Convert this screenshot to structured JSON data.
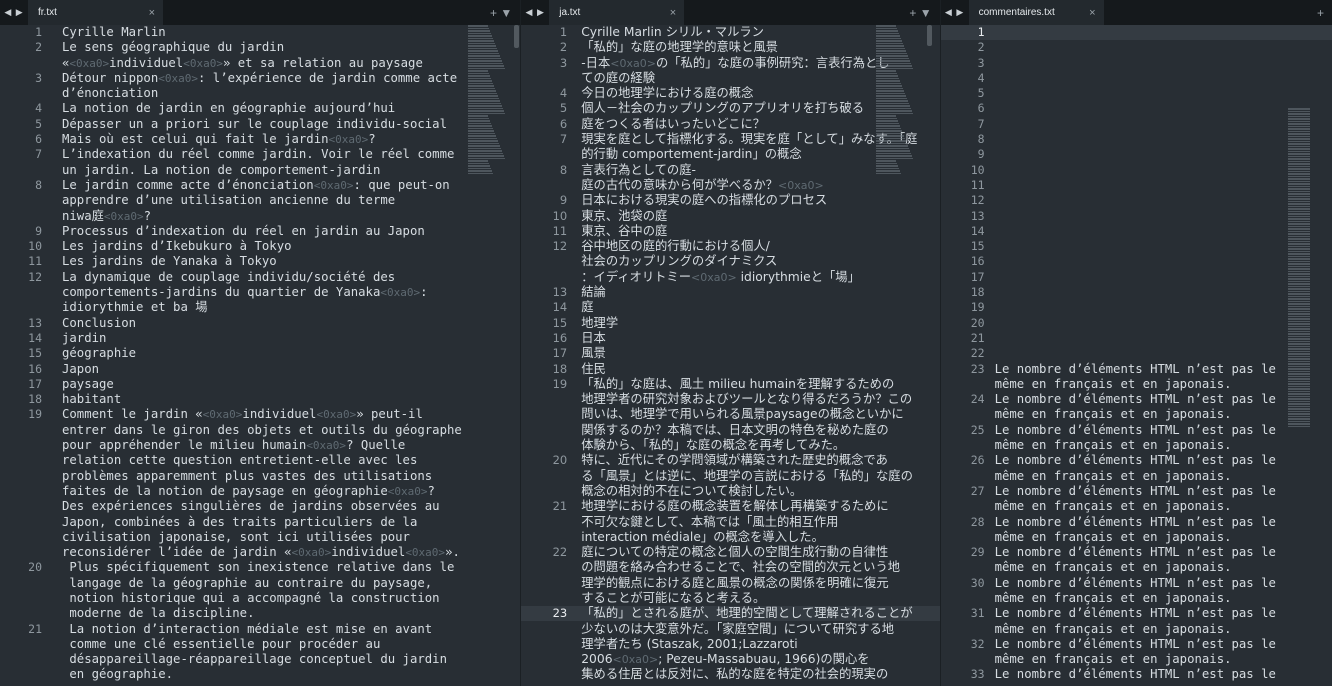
{
  "panes": [
    {
      "tab": "fr.txt",
      "rows": [
        {
          "n": "1",
          "t": "Cyrille Marlin"
        },
        {
          "n": "2",
          "t": "Le sens géographique du jardin"
        },
        {
          "n": "",
          "t": "«<0xa0>individuel<0xa0>» et sa relation au paysage"
        },
        {
          "n": "3",
          "t": "Détour nippon<0xa0>: l’expérience de jardin comme acte"
        },
        {
          "n": "",
          "t": "d’énonciation"
        },
        {
          "n": "4",
          "t": "La notion de jardin en géographie aujourd’hui"
        },
        {
          "n": "5",
          "t": "Dépasser un a priori sur le couplage individu-social"
        },
        {
          "n": "6",
          "t": "Mais où est celui qui fait le jardin<0xa0>?"
        },
        {
          "n": "7",
          "t": "L’indexation du réel comme jardin. Voir le réel comme"
        },
        {
          "n": "",
          "t": "un jardin. La notion de comportement-jardin"
        },
        {
          "n": "8",
          "t": "Le jardin comme acte d’énonciation<0xa0>: que peut-on"
        },
        {
          "n": "",
          "t": "apprendre d’une utilisation ancienne du terme"
        },
        {
          "n": "",
          "t": "niwa庭<0xa0>?"
        },
        {
          "n": "9",
          "t": "Processus d’indexation du réel en jardin au Japon"
        },
        {
          "n": "10",
          "t": "Les jardins d’Ikebukuro à Tokyo"
        },
        {
          "n": "11",
          "t": "Les jardins de Yanaka à Tokyo"
        },
        {
          "n": "12",
          "t": "La dynamique de couplage individu/société des"
        },
        {
          "n": "",
          "t": "comportements-jardins du quartier de Yanaka<0xa0>:"
        },
        {
          "n": "",
          "t": "idiorythmie et ba 場"
        },
        {
          "n": "13",
          "t": "Conclusion"
        },
        {
          "n": "14",
          "t": "jardin"
        },
        {
          "n": "15",
          "t": "géographie"
        },
        {
          "n": "16",
          "t": "Japon"
        },
        {
          "n": "17",
          "t": "paysage"
        },
        {
          "n": "18",
          "t": "habitant"
        },
        {
          "n": "19",
          "t": "Comment le jardin «<0xa0>individuel<0xa0>» peut-il"
        },
        {
          "n": "",
          "t": "entrer dans le giron des objets et outils du géographe"
        },
        {
          "n": "",
          "t": "pour appréhender le milieu humain<0xa0>? Quelle"
        },
        {
          "n": "",
          "t": "relation cette question entretient-elle avec les"
        },
        {
          "n": "",
          "t": "problèmes apparemment plus vastes des utilisations"
        },
        {
          "n": "",
          "t": "faites de la notion de paysage en géographie<0xa0>?"
        },
        {
          "n": "",
          "t": "Des expériences singulières de jardins observées au"
        },
        {
          "n": "",
          "t": "Japon, combinées à des traits particuliers de la"
        },
        {
          "n": "",
          "t": "civilisation japonaise, sont ici utilisées pour"
        },
        {
          "n": "",
          "t": "reconsidérer l’idée de jardin «<0xa0>individuel<0xa0>»."
        },
        {
          "n": "20",
          "t": " Plus spécifiquement son inexistence relative dans le"
        },
        {
          "n": "",
          "t": " langage de la géographie au contraire du paysage,"
        },
        {
          "n": "",
          "t": " notion historique qui a accompagné la construction"
        },
        {
          "n": "",
          "t": " moderne de la discipline."
        },
        {
          "n": "21",
          "t": " La notion d’interaction médiale est mise en avant"
        },
        {
          "n": "",
          "t": " comme une clé essentielle pour procéder au"
        },
        {
          "n": "",
          "t": " désappareillage-réappareillage conceptuel du jardin"
        },
        {
          "n": "",
          "t": " en géographie."
        }
      ]
    },
    {
      "tab": "ja.txt",
      "rows": [
        {
          "n": "1",
          "t": "Cyrille Marlin シリル・マルラン"
        },
        {
          "n": "2",
          "t": "「私的」な庭の地理学的意味と風景"
        },
        {
          "n": "3",
          "t": "-日本<0xa0>の「私的」な庭の事例研究：言表行為とし"
        },
        {
          "n": "",
          "t": "ての庭の経験"
        },
        {
          "n": "4",
          "t": "今日の地理学における庭の概念"
        },
        {
          "n": "5",
          "t": "個人－社会のカップリングのアプリオリを打ち破る"
        },
        {
          "n": "6",
          "t": "庭をつくる者はいったいどこに？"
        },
        {
          "n": "7",
          "t": "現実を庭として指標化する。現実を庭「として」みなす。「庭"
        },
        {
          "n": "",
          "t": "的行動 comportement-jardin」の概念"
        },
        {
          "n": "8",
          "t": "言表行為としての庭-"
        },
        {
          "n": "",
          "t": "庭の古代の意味から何が学べるか？<0xa0>"
        },
        {
          "n": "9",
          "t": "日本における現実の庭への指標化のプロセス"
        },
        {
          "n": "10",
          "t": "東京、池袋の庭"
        },
        {
          "n": "11",
          "t": "東京、谷中の庭"
        },
        {
          "n": "12",
          "t": "谷中地区の庭的行動における個人/"
        },
        {
          "n": "",
          "t": "社会のカップリングのダイナミクス"
        },
        {
          "n": "",
          "t": "：イディオリトミー<0xa0> idiorythmieと「場」"
        },
        {
          "n": "13",
          "t": "結論"
        },
        {
          "n": "14",
          "t": "庭"
        },
        {
          "n": "15",
          "t": "地理学"
        },
        {
          "n": "16",
          "t": "日本"
        },
        {
          "n": "17",
          "t": "風景"
        },
        {
          "n": "18",
          "t": "住民"
        },
        {
          "n": "19",
          "t": "「私的」な庭は、風土 milieu humainを理解するための"
        },
        {
          "n": "",
          "t": "地理学者の研究対象およびツールとなり得るだろうか？この"
        },
        {
          "n": "",
          "t": "問いは、地理学で用いられる風景paysageの概念といかに"
        },
        {
          "n": "",
          "t": "関係するのか？本稿では、日本文明の特色を秘めた庭の"
        },
        {
          "n": "",
          "t": "体験から、「私的」な庭の概念を再考してみた。"
        },
        {
          "n": "20",
          "t": "特に、近代にその学問領域が構築された歴史的概念であ"
        },
        {
          "n": "",
          "t": "る「風景」とは逆に、地理学の言説における「私的」な庭の"
        },
        {
          "n": "",
          "t": "概念の相対的不在について検討したい。"
        },
        {
          "n": "21",
          "t": "地理学における庭の概念装置を解体し再構築するために"
        },
        {
          "n": "",
          "t": "不可欠な鍵として、本稿では「風土的相互作用"
        },
        {
          "n": "",
          "t": "interaction médiale」の概念を導入した。"
        },
        {
          "n": "22",
          "t": "庭についての特定の概念と個人の空間生成行動の自律性"
        },
        {
          "n": "",
          "t": "の問題を絡み合わせることで、社会の空間的次元という地"
        },
        {
          "n": "",
          "t": "理学的観点における庭と風景の概念の関係を明確に復元"
        },
        {
          "n": "",
          "t": "することが可能になると考える。"
        },
        {
          "n": "23",
          "t": "「私的」とされる庭が、地理的空間として理解されることが"
        },
        {
          "n": "",
          "t": "少ないのは大変意外だ。「家庭空間」について研究する地"
        },
        {
          "n": "",
          "t": "理学者たち (Staszak, 2001;Lazzaroti"
        },
        {
          "n": "",
          "t": "2006<0xa0>; Pezeu-Massabuau, 1966)の関心を"
        },
        {
          "n": "",
          "t": "集める住居とは反対に、私的な庭を特定の社会的現実の"
        }
      ]
    },
    {
      "tab": "commentaires.txt",
      "rows": [
        {
          "n": "1",
          "t": ""
        },
        {
          "n": "2",
          "t": ""
        },
        {
          "n": "3",
          "t": ""
        },
        {
          "n": "4",
          "t": ""
        },
        {
          "n": "5",
          "t": ""
        },
        {
          "n": "6",
          "t": ""
        },
        {
          "n": "7",
          "t": ""
        },
        {
          "n": "8",
          "t": ""
        },
        {
          "n": "9",
          "t": ""
        },
        {
          "n": "10",
          "t": ""
        },
        {
          "n": "11",
          "t": ""
        },
        {
          "n": "12",
          "t": ""
        },
        {
          "n": "13",
          "t": ""
        },
        {
          "n": "14",
          "t": ""
        },
        {
          "n": "15",
          "t": ""
        },
        {
          "n": "16",
          "t": ""
        },
        {
          "n": "17",
          "t": ""
        },
        {
          "n": "18",
          "t": ""
        },
        {
          "n": "19",
          "t": ""
        },
        {
          "n": "20",
          "t": ""
        },
        {
          "n": "21",
          "t": ""
        },
        {
          "n": "22",
          "t": ""
        },
        {
          "n": "23",
          "t": "Le nombre d’éléments HTML n’est pas le"
        },
        {
          "n": "",
          "t": "même en français et en japonais."
        },
        {
          "n": "24",
          "t": "Le nombre d’éléments HTML n’est pas le"
        },
        {
          "n": "",
          "t": "même en français et en japonais."
        },
        {
          "n": "25",
          "t": "Le nombre d’éléments HTML n’est pas le"
        },
        {
          "n": "",
          "t": "même en français et en japonais."
        },
        {
          "n": "26",
          "t": "Le nombre d’éléments HTML n’est pas le"
        },
        {
          "n": "",
          "t": "même en français et en japonais."
        },
        {
          "n": "27",
          "t": "Le nombre d’éléments HTML n’est pas le"
        },
        {
          "n": "",
          "t": "même en français et en japonais."
        },
        {
          "n": "28",
          "t": "Le nombre d’éléments HTML n’est pas le"
        },
        {
          "n": "",
          "t": "même en français et en japonais."
        },
        {
          "n": "29",
          "t": "Le nombre d’éléments HTML n’est pas le"
        },
        {
          "n": "",
          "t": "même en français et en japonais."
        },
        {
          "n": "30",
          "t": "Le nombre d’éléments HTML n’est pas le"
        },
        {
          "n": "",
          "t": "même en français et en japonais."
        },
        {
          "n": "31",
          "t": "Le nombre d’éléments HTML n’est pas le"
        },
        {
          "n": "",
          "t": "même en français et en japonais."
        },
        {
          "n": "32",
          "t": "Le nombre d’éléments HTML n’est pas le"
        },
        {
          "n": "",
          "t": "même en français et en japonais."
        },
        {
          "n": "33",
          "t": "Le nombre d’éléments HTML n’est pas le"
        }
      ]
    }
  ],
  "controls": {
    "nav_arrows": "◀ ▶",
    "tab_close": "×",
    "pane_add": "+ ▼",
    "pane_add_last": "+"
  },
  "colors": {
    "editor_bg": "#282e34",
    "tabbar_bg": "#15191c",
    "active_tab_bg": "#23292e",
    "text": "#d7dde2",
    "whitespace_marker": "#5f6a72",
    "line_number": "#8f989f",
    "active_line_bg": "#343b42"
  },
  "icons": {
    "nav": "left-right-arrows-icon",
    "close": "close-icon",
    "add": "plus-icon",
    "menu": "chevron-down-icon"
  }
}
